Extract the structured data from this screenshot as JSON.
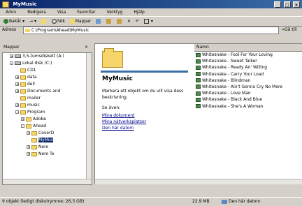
{
  "window": {
    "title": "MyMusic"
  },
  "menu": [
    "Arkiv",
    "Redigera",
    "Visa",
    "Favoriter",
    "Verktyg",
    "Hjälp"
  ],
  "toolbar": {
    "back": "Bakåt",
    "search": "Sök",
    "folders": "Mappar"
  },
  "address": {
    "label": "Adress",
    "value": "C:\\Program\\Ahead\\MyMusic",
    "go": "Gå till"
  },
  "folders_panel": {
    "title": "Mappar",
    "items": [
      {
        "label": "3,5-tumsdiskett (A:)",
        "type": "drive",
        "indent": 1,
        "expander": "+"
      },
      {
        "label": "Lokal disk (C:)",
        "type": "drive",
        "indent": 1,
        "expander": "-"
      },
      {
        "label": "CD1",
        "type": "folder",
        "indent": 2,
        "expander": ""
      },
      {
        "label": "data",
        "type": "folder",
        "indent": 2,
        "expander": "+"
      },
      {
        "label": "dell",
        "type": "folder",
        "indent": 2,
        "expander": "+"
      },
      {
        "label": "Documents and",
        "type": "folder",
        "indent": 2,
        "expander": "+"
      },
      {
        "label": "mailer",
        "type": "folder",
        "indent": 2,
        "expander": ""
      },
      {
        "label": "music",
        "type": "folder",
        "indent": 2,
        "expander": "+"
      },
      {
        "label": "Program",
        "type": "folder",
        "indent": 2,
        "expander": "-"
      },
      {
        "label": "Adobe",
        "type": "folder",
        "indent": 3,
        "expander": "+"
      },
      {
        "label": "Ahead",
        "type": "folder",
        "indent": 3,
        "expander": "-"
      },
      {
        "label": "CoverD",
        "type": "folder",
        "indent": 4,
        "expander": "+"
      },
      {
        "label": "MyMus",
        "type": "folder",
        "indent": 4,
        "expander": "",
        "selected": true
      },
      {
        "label": "Nero",
        "type": "folder",
        "indent": 4,
        "expander": "+"
      },
      {
        "label": "Nero To",
        "type": "folder",
        "indent": 4,
        "expander": "+"
      }
    ]
  },
  "info_pane": {
    "title": "MyMusic",
    "description": "Markera ett objekt om du vill visa dess beskrivning.",
    "see_also": "Se även:",
    "links": [
      "Mina dokument",
      "Mina nätverksplatser",
      "Den här datorn"
    ]
  },
  "file_list": {
    "column": "Namn",
    "items": [
      "Whitesnake - Fool For Your Loving",
      "Whitesnake - Sweet Talker",
      "Whitesnake - Ready An' Willing",
      "Whitesnake - Carry Your Load",
      "Whitesnake - Blindman",
      "Whitesnake - Ain't Gonna Cry No More",
      "Whitesnake - Love Man",
      "Whitesnake - Black And Blue",
      "Whitesnake - She's A Woman"
    ]
  },
  "status": {
    "objects": "9 objekt (ledigt diskutrymme: 26,5 GB)",
    "size": "22,9 MB",
    "location": "Den här datorn"
  }
}
